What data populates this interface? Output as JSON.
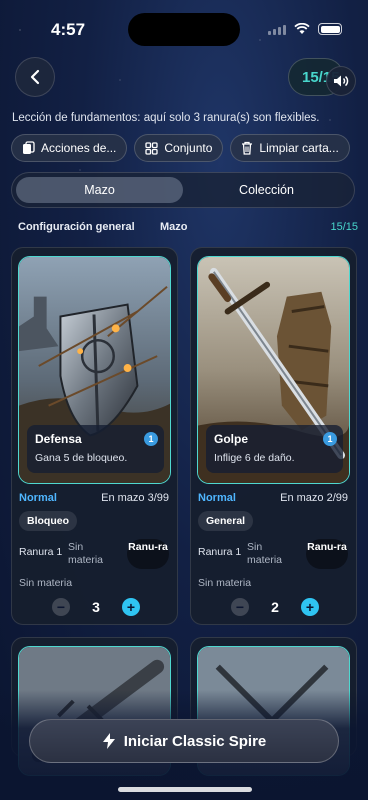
{
  "status": {
    "time": "4:57"
  },
  "header": {
    "counter": "15/15"
  },
  "lesson_text": "Lección de fundamentos: aquí solo 3 ranura(s) son flexibles.",
  "actions": [
    {
      "label": "Acciones de...",
      "icon": "deck-actions-icon"
    },
    {
      "label": "Conjunto",
      "icon": "grid-icon"
    },
    {
      "label": "Limpiar carta...",
      "icon": "trash-icon"
    }
  ],
  "tabs": [
    {
      "label": "Mazo",
      "active": true
    },
    {
      "label": "Colección",
      "active": false
    }
  ],
  "subheader": {
    "config": "Configuración general",
    "deck": "Mazo",
    "count": "15/15"
  },
  "cards": [
    {
      "name": "Defensa",
      "cost": "1",
      "description": "Gana 5 de bloqueo.",
      "rarity": "Normal",
      "in_deck": "En mazo 3/99",
      "tag": "Bloqueo",
      "slot_label": "Ranura 1",
      "slot_material": "Sin materia",
      "slot_button": "Ranu-ra",
      "no_material": "Sin materia",
      "quantity": "3",
      "art": "shield-art"
    },
    {
      "name": "Golpe",
      "cost": "1",
      "description": "Inflige 6 de daño.",
      "rarity": "Normal",
      "in_deck": "En mazo 2/99",
      "tag": "General",
      "slot_label": "Ranura 1",
      "slot_material": "Sin materia",
      "slot_button": "Ranu-ra",
      "no_material": "Sin materia",
      "quantity": "2",
      "art": "sword-art"
    }
  ],
  "start_button": {
    "label": "Iniciar Classic Spire",
    "icon": "lightning-icon"
  },
  "colors": {
    "accent": "#48d6cc",
    "rarity": "#4fb6ff",
    "plus": "#2fc4f2"
  }
}
